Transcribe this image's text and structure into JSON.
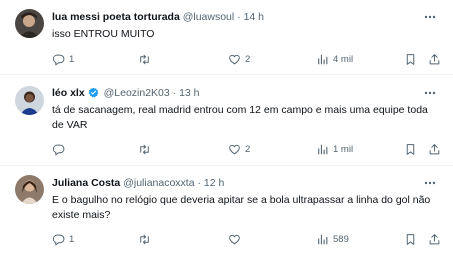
{
  "tweets": [
    {
      "name": "lua messi poeta torturada",
      "handle": "@luawsoul",
      "dot": "·",
      "time": "14 h",
      "verified": false,
      "text": "isso ENTROU MUITO",
      "replies": "1",
      "retweets": "",
      "likes": "2",
      "views": "4 mil"
    },
    {
      "name": "léo xlx",
      "handle": "@Leozin2K03",
      "dot": "·",
      "time": "13 h",
      "verified": true,
      "text": "tá de sacanagem, real madrid entrou com 12 em campo e mais uma equipe toda de VAR",
      "replies": "",
      "retweets": "",
      "likes": "2",
      "views": "1 mil"
    },
    {
      "name": "Juliana Costa",
      "handle": "@julianacoxxta",
      "dot": "·",
      "time": "12 h",
      "verified": false,
      "text": "E o bagulho no relógio que deveria apitar se a bola ultrapassar a linha do gol não existe mais?",
      "replies": "1",
      "retweets": "",
      "likes": "",
      "views": "589"
    }
  ],
  "colors": {
    "text": "#0f1419",
    "muted": "#536471",
    "divider": "#eff3f4",
    "verified": "#1d9bf0"
  },
  "icons": [
    "more-icon",
    "reply-icon",
    "retweet-icon",
    "like-icon",
    "views-icon",
    "bookmark-icon",
    "share-icon",
    "verified-icon"
  ]
}
